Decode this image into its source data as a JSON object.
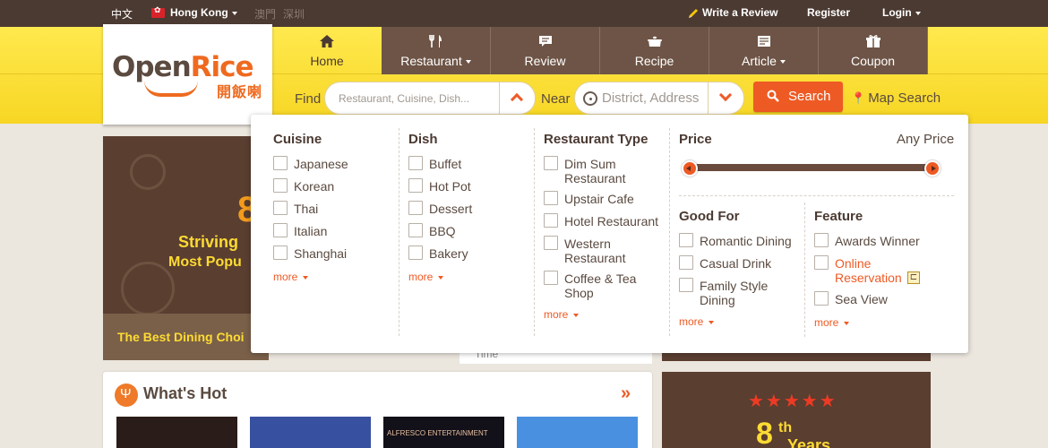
{
  "topbar": {
    "language": "中文",
    "region": "Hong Kong",
    "city_macau": "澳門",
    "city_shenzhen": "深圳",
    "write_review": "Write a Review",
    "register": "Register",
    "login": "Login"
  },
  "logo": {
    "text_open": "Open",
    "text_rice": "Rice",
    "text_cn": "開飯喇"
  },
  "nav": [
    {
      "label": "Home",
      "icon": "home-icon",
      "active": true
    },
    {
      "label": "Restaurant",
      "icon": "fork-knife-icon",
      "dropdown": true
    },
    {
      "label": "Review",
      "icon": "speech-bubble-icon"
    },
    {
      "label": "Recipe",
      "icon": "pot-icon"
    },
    {
      "label": "Article",
      "icon": "newspaper-icon",
      "dropdown": true
    },
    {
      "label": "Coupon",
      "icon": "gift-icon"
    }
  ],
  "search": {
    "find_label": "Find",
    "find_placeholder": "Restaurant, Cuisine, Dish...",
    "near_label": "Near",
    "near_placeholder": "District, Address",
    "search_button": "Search",
    "map_search": "Map Search"
  },
  "dropdown": {
    "cuisine": {
      "title": "Cuisine",
      "options": [
        "Japanese",
        "Korean",
        "Thai",
        "Italian",
        "Shanghai"
      ],
      "more": "more"
    },
    "dish": {
      "title": "Dish",
      "options": [
        "Buffet",
        "Hot Pot",
        "Dessert",
        "BBQ",
        "Bakery"
      ],
      "more": "more"
    },
    "restaurant_type": {
      "title": "Restaurant Type",
      "options": [
        "Dim Sum Restaurant",
        "Upstair Cafe",
        "Hotel Restaurant",
        "Western Restaurant",
        "Coffee & Tea Shop"
      ],
      "more": "more"
    },
    "price": {
      "title": "Price",
      "value": "Any Price"
    },
    "good_for": {
      "title": "Good For",
      "options": [
        "Romantic Dining",
        "Casual Drink",
        "Family Style Dining"
      ],
      "more": "more"
    },
    "feature": {
      "title": "Feature",
      "options": [
        "Awards Winner",
        "Online Reservation",
        "Sea View"
      ],
      "more": "more"
    }
  },
  "background": {
    "banner_striving": "Striving",
    "banner_most_popular": "Most Popu",
    "banner_best_dining": "The Best Dining Choi",
    "mid_time": "Time",
    "whats_hot_title": "What's Hot",
    "thumb3_text": "ALFRESCO ENTERTAINMENT",
    "right_banner_8": "8",
    "right_banner_th": "th",
    "right_banner_years": "Years"
  },
  "colors": {
    "brand_brown": "#4b3a32",
    "nav_brown": "#6e5446",
    "header_yellow": "#fde54a",
    "accent_orange": "#ee5a24"
  }
}
